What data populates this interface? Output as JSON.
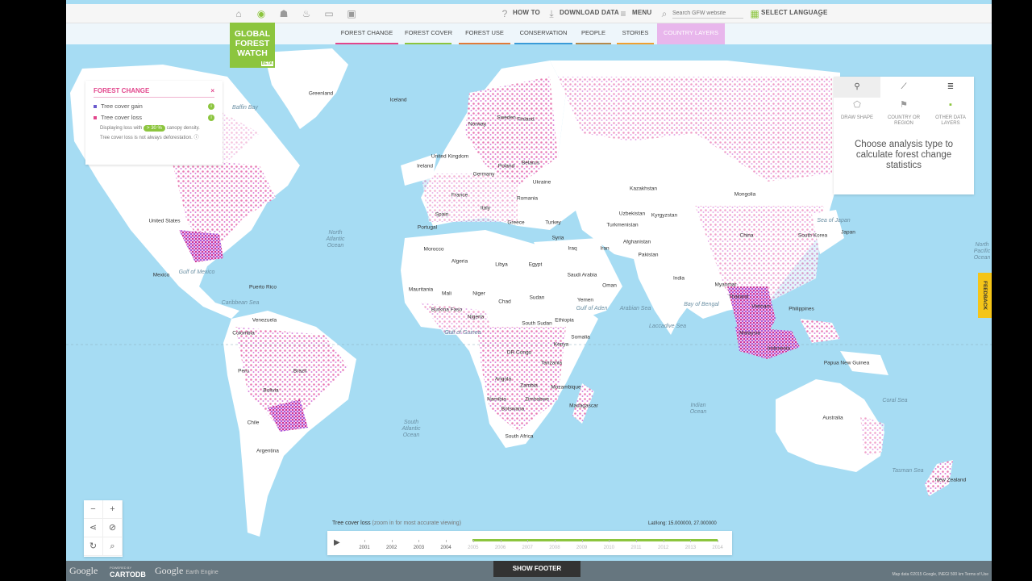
{
  "colors": {
    "accent": "#8cc53e",
    "loss": "#e2468c",
    "gain": "#6a5acd",
    "ocean": "#a6dcf3",
    "land": "#ffffff",
    "active_tab": "#e8b6ec"
  },
  "topbar": {
    "icons": [
      "home-icon",
      "globe-icon",
      "person-icon",
      "fire-icon",
      "truck-icon",
      "picture-icon"
    ],
    "how_to": "HOW TO",
    "download": "DOWNLOAD DATA",
    "menu": "MENU",
    "search_placeholder": "Search GFW website",
    "language": "SELECT LANGUAGE"
  },
  "logo": {
    "line1": "GLOBAL",
    "line2": "FOREST",
    "line3": "WATCH",
    "beta": "BETA"
  },
  "nav": {
    "tabs": [
      {
        "label": "FOREST CHANGE",
        "color": "#e2468c"
      },
      {
        "label": "FOREST COVER",
        "color": "#8cc53e"
      },
      {
        "label": "FOREST USE",
        "color": "#e07b39"
      },
      {
        "label": "CONSERVATION",
        "color": "#3a9bd8"
      },
      {
        "label": "PEOPLE",
        "color": "#b58a4c"
      },
      {
        "label": "STORIES",
        "color": "#f0a030"
      },
      {
        "label": "COUNTRY LAYERS",
        "color": "#e8b6ec"
      }
    ]
  },
  "legend": {
    "title": "FOREST CHANGE",
    "gain": "Tree cover gain",
    "loss": "Tree cover loss",
    "density_pre": "Displaying loss with",
    "density_badge": "> 30 %",
    "density_post": "canopy density.",
    "note": "Tree cover loss is not always deforestation."
  },
  "analysis": {
    "types": [
      {
        "label": "DRAW SHAPE",
        "icon": "polygon-icon"
      },
      {
        "label": "COUNTRY OR REGION",
        "icon": "flag-icon"
      },
      {
        "label": "OTHER DATA LAYERS",
        "icon": "layers-icon"
      }
    ],
    "message": "Choose analysis type to calculate forest change statistics"
  },
  "feedback": "FEEDBACK",
  "labels": {
    "greenland": "Greenland",
    "iceland": "Iceland",
    "norway": "Norway",
    "sweden": "Sweden",
    "finland": "Finland",
    "uk": "United Kingdom",
    "ireland": "Ireland",
    "poland": "Poland",
    "belarus": "Belarus",
    "ukraine": "Ukraine",
    "germany": "Germany",
    "france": "France",
    "spain": "Spain",
    "portugal": "Portugal",
    "italy": "Italy",
    "romania": "Romania",
    "greece": "Greece",
    "turkey": "Turkey",
    "kazakhstan": "Kazakhstan",
    "mongolia": "Mongolia",
    "uzbekistan": "Uzbekistan",
    "turkmenistan": "Turkmenistan",
    "kyrgyzstan": "Kyrgyzstan",
    "afghanistan": "Afghanistan",
    "iran": "Iran",
    "iraq": "Iraq",
    "syria": "Syria",
    "pakistan": "Pakistan",
    "china": "China",
    "india": "India",
    "south_korea": "South Korea",
    "japan": "Japan",
    "sea_japan": "Sea of Japan",
    "myanmar": "Myanmar",
    "thailand": "Thailand",
    "vietnam": "Vietnam",
    "philippines": "Philippines",
    "malaysia": "Malaysia",
    "indonesia": "Indonesia",
    "png": "Papua New Guinea",
    "australia": "Australia",
    "new_zealand": "New Zealand",
    "morocco": "Morocco",
    "algeria": "Algeria",
    "libya": "Libya",
    "egypt": "Egypt",
    "saudi": "Saudi Arabia",
    "oman": "Oman",
    "yemen": "Yemen",
    "mauritania": "Mauritania",
    "mali": "Mali",
    "niger": "Niger",
    "chad": "Chad",
    "sudan": "Sudan",
    "south_sudan": "South Sudan",
    "ethiopia": "Ethiopia",
    "somalia": "Somalia",
    "nigeria": "Nigeria",
    "burkina": "Burkina Faso",
    "kenya": "Kenya",
    "drc": "DR Congo",
    "tanzania": "Tanzania",
    "angola": "Angola",
    "zambia": "Zambia",
    "mozambique": "Mozambique",
    "zimbabwe": "Zimbabwe",
    "namibia": "Namibia",
    "botswana": "Botswana",
    "south_africa": "South Africa",
    "madagascar": "Madagascar",
    "united_states": "United States",
    "mexico": "Mexico",
    "puerto_rico": "Puerto Rico",
    "venezuela": "Venezuela",
    "colombia": "Colombia",
    "peru": "Peru",
    "brazil": "Brazil",
    "bolivia": "Bolivia",
    "chile": "Chile",
    "argentina": "Argentina",
    "gulf_mexico": "Gulf of Mexico",
    "caribbean": "Caribbean Sea",
    "gulf_guinea": "Gulf of Guinea",
    "gulf_aden": "Gulf of Aden",
    "arabian_sea": "Arabian Sea",
    "bay_bengal": "Bay of Bengal",
    "laccadive": "Laccadive Sea",
    "coral_sea": "Coral Sea",
    "tasman": "Tasman Sea",
    "baffin": "Baffin Bay",
    "north_atlantic": "North\nAtlantic\nOcean",
    "south_atlantic": "South\nAtlantic\nOcean",
    "indian_ocean": "Indian\nOcean",
    "north_pacific": "North\nPacific\nOcean"
  },
  "timeline": {
    "title": "Tree cover loss",
    "subtitle": "(zoom in for most accurate viewing)",
    "latlng": "Lat/long: 15.000000, 27.000000",
    "years": [
      "2001",
      "2002",
      "2003",
      "2004",
      "2005",
      "2006",
      "2007",
      "2008",
      "2009",
      "2010",
      "2011",
      "2012",
      "2013",
      "2014"
    ],
    "start_year": "2005",
    "end_year": "2014"
  },
  "footer": {
    "show_footer": "SHOW FOOTER",
    "google": "Google",
    "cartodb": "CARTODB",
    "cartodb_powered": "POWERED BY",
    "google_ee": "Google",
    "earth_engine": "Earth Engine",
    "attribution": "Map data ©2015 Google, INEGI   500 km   Terms of Use"
  }
}
